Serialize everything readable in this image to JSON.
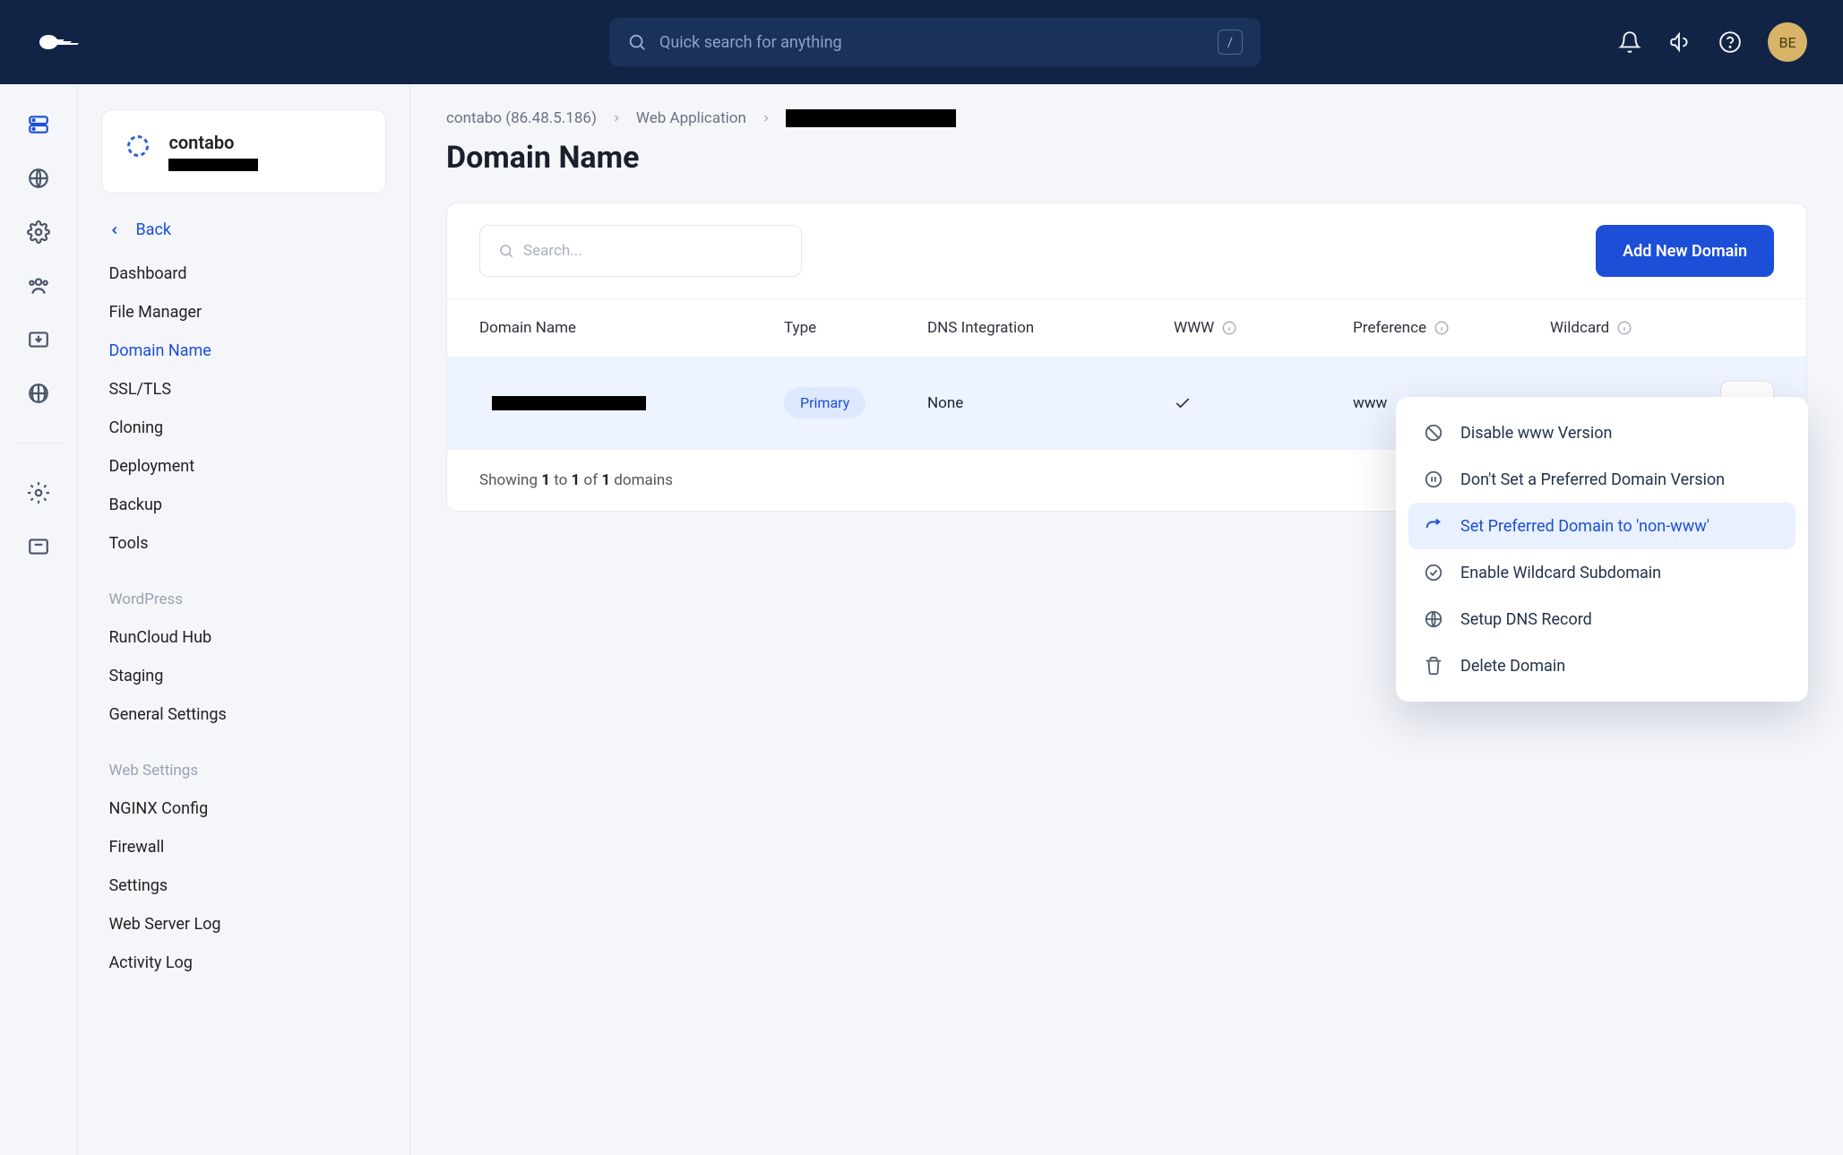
{
  "header": {
    "search_placeholder": "Quick search for anything",
    "kbd_hint": "/",
    "avatar_initials": "BE"
  },
  "server_card": {
    "name": "contabo"
  },
  "sidebar": {
    "back_label": "Back",
    "items": [
      {
        "label": "Dashboard"
      },
      {
        "label": "File Manager"
      },
      {
        "label": "Domain Name"
      },
      {
        "label": "SSL/TLS"
      },
      {
        "label": "Cloning"
      },
      {
        "label": "Deployment"
      },
      {
        "label": "Backup"
      },
      {
        "label": "Tools"
      }
    ],
    "section_wp": {
      "heading": "WordPress",
      "items": [
        {
          "label": "RunCloud Hub"
        },
        {
          "label": "Staging"
        },
        {
          "label": "General Settings"
        }
      ]
    },
    "section_web": {
      "heading": "Web Settings",
      "items": [
        {
          "label": "NGINX Config"
        },
        {
          "label": "Firewall"
        },
        {
          "label": "Settings"
        },
        {
          "label": "Web Server Log"
        },
        {
          "label": "Activity Log"
        }
      ]
    }
  },
  "breadcrumbs": {
    "server": "contabo (86.48.5.186)",
    "section": "Web Application"
  },
  "page": {
    "title": "Domain Name",
    "search_placeholder": "Search...",
    "add_button": "Add New Domain"
  },
  "table": {
    "columns": {
      "domain": "Domain Name",
      "type": "Type",
      "dns": "DNS Integration",
      "www": "WWW",
      "preference": "Preference",
      "wildcard": "Wildcard"
    },
    "rows": [
      {
        "type_badge": "Primary",
        "dns": "None",
        "www_checked": true,
        "preference": "www",
        "wildcard": "-"
      }
    ],
    "footer": {
      "prefix": "Showing ",
      "from": "1",
      "to_word": " to ",
      "to": "1",
      "of_word": " of ",
      "total": "1",
      "suffix": " domains"
    }
  },
  "dropdown": {
    "items": [
      {
        "label": "Disable www Version"
      },
      {
        "label": "Don't Set a Preferred Domain Version"
      },
      {
        "label": "Set Preferred Domain to 'non-www'"
      },
      {
        "label": "Enable Wildcard Subdomain"
      },
      {
        "label": "Setup DNS Record"
      },
      {
        "label": "Delete Domain"
      }
    ]
  }
}
